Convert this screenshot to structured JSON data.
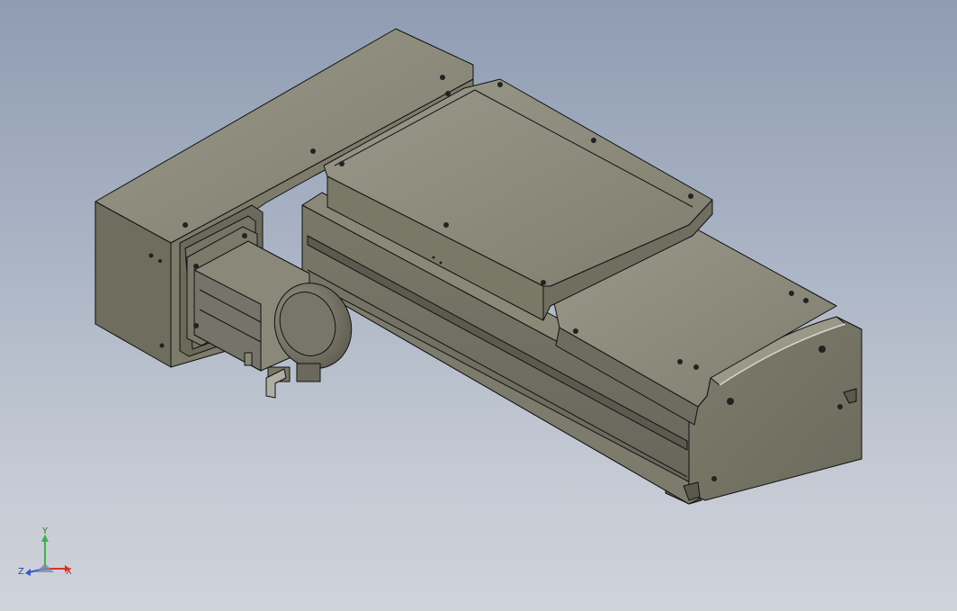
{
  "triad": {
    "x_label": "X",
    "y_label": "Y",
    "z_label": "Z"
  },
  "colors": {
    "background_top": "#8f9cb2",
    "background_bottom": "#cfd3da",
    "part_top_face": "#8e8d7c",
    "part_side_face": "#6f6e5f",
    "part_front_face": "#7b7a6a",
    "edge": "#111111",
    "axis_x": "#e0302a",
    "axis_y": "#3bb24a",
    "axis_z": "#2e58d6"
  },
  "model": {
    "components": [
      "motor-bracket",
      "motor",
      "encoder",
      "cable-connector",
      "actuator-rail",
      "slider-carriage",
      "end-plate"
    ]
  }
}
